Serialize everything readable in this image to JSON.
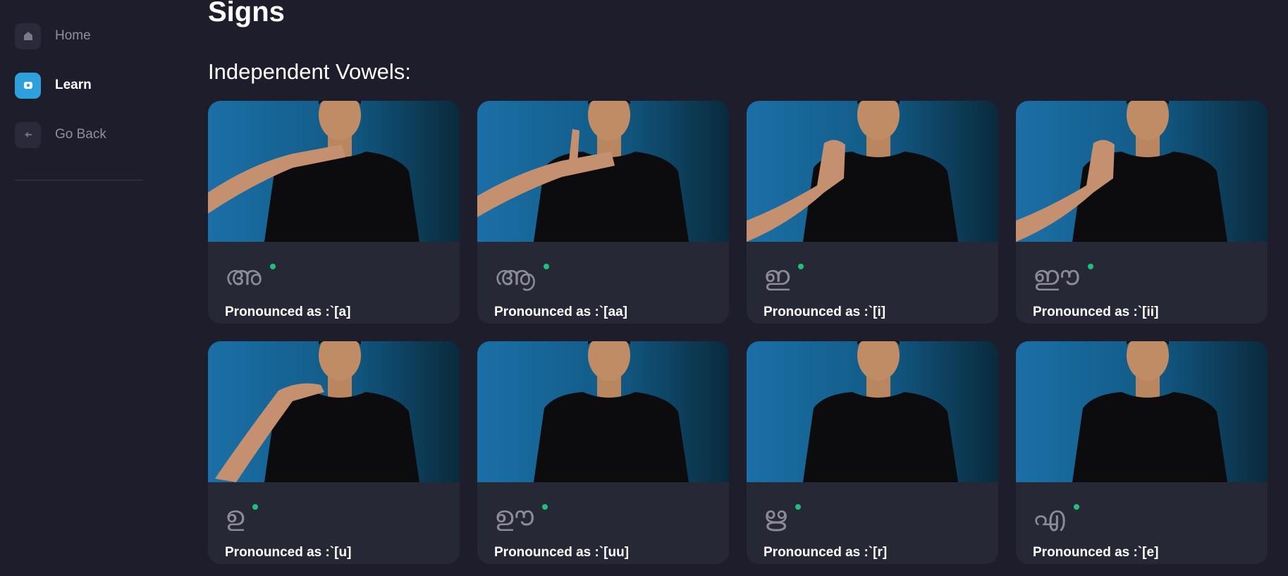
{
  "nav": {
    "items": [
      {
        "label": "Home",
        "icon": "home-icon",
        "active": false
      },
      {
        "label": "Learn",
        "icon": "learn-icon",
        "active": true
      },
      {
        "label": "Go Back",
        "icon": "back-arrow-icon",
        "active": false
      }
    ]
  },
  "page": {
    "title": "Signs",
    "section_title": "Independent Vowels:"
  },
  "cards": [
    {
      "letter": "അ",
      "caption": "Pronounced as :`[a]",
      "pose": "flat-hand-horizontal"
    },
    {
      "letter": "ആ",
      "caption": "Pronounced as :`[aa]",
      "pose": "flat-hand-thumb-up"
    },
    {
      "letter": "ഇ",
      "caption": "Pronounced as :`[i]",
      "pose": "fist-raised"
    },
    {
      "letter": "ഈ",
      "caption": "Pronounced as :`[ii]",
      "pose": "fist-raised"
    },
    {
      "letter": "ഉ",
      "caption": "Pronounced as :`[u]",
      "pose": "pinch-hand"
    },
    {
      "letter": "ഊ",
      "caption": "Pronounced as :`[uu]",
      "pose": "none"
    },
    {
      "letter": "ഋ",
      "caption": "Pronounced as :`[r]",
      "pose": "none"
    },
    {
      "letter": "എ",
      "caption": "Pronounced as :`[e]",
      "pose": "none"
    }
  ],
  "colors": {
    "background": "#1e1d2c",
    "card": "#272836",
    "accent": "#2ea0db",
    "status_dot": "#1fbf7a"
  }
}
